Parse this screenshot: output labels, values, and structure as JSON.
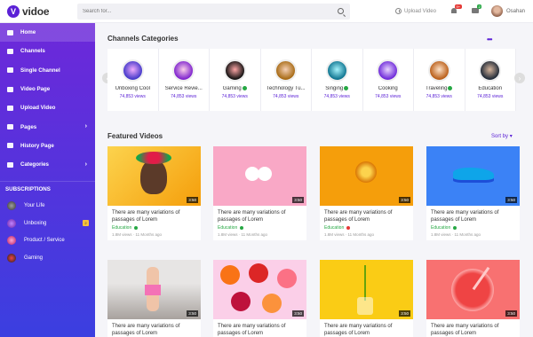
{
  "header": {
    "logo_letter": "V",
    "logo_text": "vidoe",
    "search_placeholder": "Search for...",
    "upload_label": "Upload Video",
    "notif_count": "9+",
    "message_count": "2",
    "username": "Osahan"
  },
  "sidebar": {
    "items": [
      {
        "label": "Home",
        "active": true
      },
      {
        "label": "Channels"
      },
      {
        "label": "Single Channel"
      },
      {
        "label": "Video Page"
      },
      {
        "label": "Upload Video"
      },
      {
        "label": "Pages",
        "chevron": true
      },
      {
        "label": "History Page"
      },
      {
        "label": "Categories",
        "chevron": true
      }
    ],
    "subscriptions_title": "SUBSCRIPTIONS",
    "subscriptions": [
      {
        "label": "Your Life"
      },
      {
        "label": "Unboxing",
        "badge": "2"
      },
      {
        "label": "Product / Service"
      },
      {
        "label": "Gaming"
      }
    ]
  },
  "categories": {
    "title": "Channels Categories",
    "items": [
      {
        "name": "Unboxing Cool",
        "views": "74,853 views",
        "verified": false
      },
      {
        "name": "Service Revie...",
        "views": "74,853 views",
        "verified": false
      },
      {
        "name": "Gaming",
        "views": "74,853 views",
        "verified": true
      },
      {
        "name": "Technology Tu...",
        "views": "74,853 views",
        "verified": false
      },
      {
        "name": "Singing",
        "views": "74,853 views",
        "verified": true
      },
      {
        "name": "Cooking",
        "views": "74,853 views",
        "verified": false
      },
      {
        "name": "Traveling",
        "views": "74,853 views",
        "verified": true
      },
      {
        "name": "Education",
        "views": "74,853 views",
        "verified": false
      }
    ]
  },
  "featured": {
    "title": "Featured Videos",
    "sort_label": "Sort by",
    "videos": [
      {
        "title": "There are many variations of passages of Lorem",
        "category": "Education",
        "dot": "green",
        "views": "1.8M views",
        "time": "11 Months ago",
        "duration": "3:50"
      },
      {
        "title": "There are many variations of passages of Lorem",
        "category": "Education",
        "dot": "green",
        "views": "1.8M views",
        "time": "11 Months ago",
        "duration": "3:50"
      },
      {
        "title": "There are many variations of passages of Lorem",
        "category": "Education",
        "dot": "red",
        "views": "1.8M views",
        "time": "11 Months ago",
        "duration": "3:50"
      },
      {
        "title": "There are many variations of passages of Lorem",
        "category": "Education",
        "dot": "green",
        "views": "1.8M views",
        "time": "11 Months ago",
        "duration": "3:50"
      },
      {
        "title": "There are many variations of passages of Lorem",
        "duration": "3:50"
      },
      {
        "title": "There are many variations of passages of Lorem",
        "duration": "3:50"
      },
      {
        "title": "There are many variations of passages of Lorem",
        "duration": "3:50"
      },
      {
        "title": "There are many variations of passages of Lorem",
        "duration": "3:50"
      }
    ]
  },
  "colors": {
    "accent": "#5b21d6",
    "sidebar_top": "#6d28d9",
    "sidebar_bottom": "#3b3fe0",
    "verified": "#27a844",
    "alert": "#e53935"
  }
}
